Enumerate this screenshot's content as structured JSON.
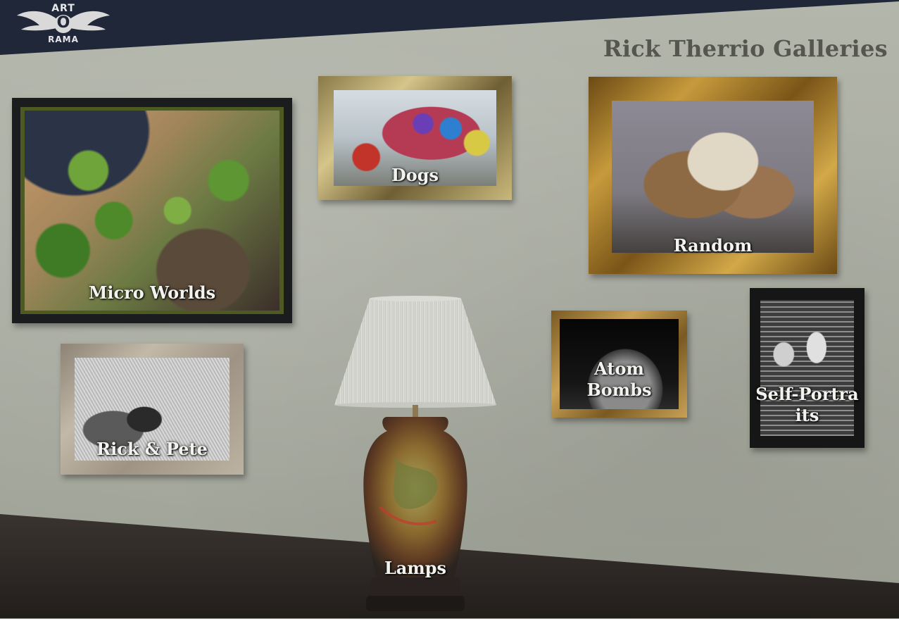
{
  "brand": {
    "logo_top": "ART",
    "logo_middle": "O",
    "logo_bottom": "RAMA"
  },
  "page": {
    "title": "Rick Therrio Galleries"
  },
  "galleries": [
    {
      "label": "Micro Worlds"
    },
    {
      "label": "Dogs"
    },
    {
      "label": "Random"
    },
    {
      "label": "Rick & Pete"
    },
    {
      "label": "Atom Bombs"
    },
    {
      "label": "Self-Portraits"
    },
    {
      "label": "Lamps"
    }
  ],
  "colors": {
    "top_band": "#1f2739",
    "wall": "#a9aca2",
    "floor": "#2f2a27",
    "title_text": "#55574f",
    "label_text": "#f2f2ee"
  }
}
